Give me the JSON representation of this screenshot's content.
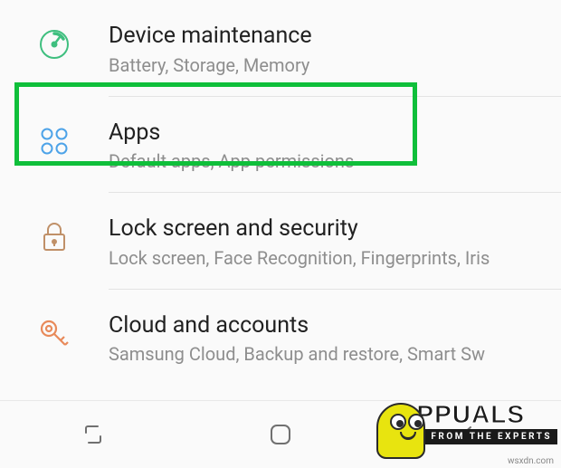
{
  "settings": [
    {
      "id": "device-maintenance",
      "title": "Device maintenance",
      "subtitle": "Battery, Storage, Memory",
      "icon": "gauge-icon",
      "color": "#3fbf7f"
    },
    {
      "id": "apps",
      "title": "Apps",
      "subtitle": "Default apps, App permissions",
      "icon": "grid-icon",
      "color": "#4da3e8"
    },
    {
      "id": "lock-screen-security",
      "title": "Lock screen and security",
      "subtitle": "Lock screen, Face Recognition, Fingerprints, Iris",
      "icon": "lock-icon",
      "color": "#c09068"
    },
    {
      "id": "cloud-accounts",
      "title": "Cloud and accounts",
      "subtitle": "Samsung Cloud, Backup and restore, Smart Sw",
      "icon": "key-icon",
      "color": "#e88a5a"
    }
  ],
  "watermark": {
    "brand": "PPUALS",
    "tagline": "FROM THE EXPERTS"
  },
  "source": "wsxdn.com",
  "highlight_color": "#0fbf3a"
}
